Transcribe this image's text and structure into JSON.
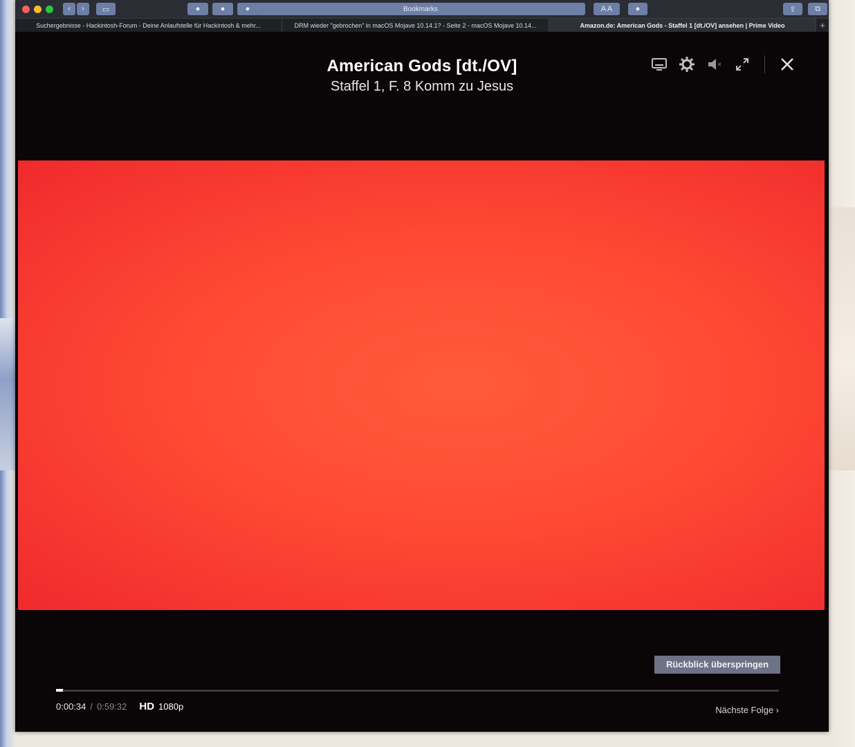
{
  "browser": {
    "url_text": "Bookmarks",
    "tabs": [
      {
        "label": "Suchergebnisse - Hackintosh-Forum - Deine Anlaufstelle für Hackintosh & mehr...",
        "active": false
      },
      {
        "label": "DRM wieder \"gebrochen\" in macOS Mojave 10.14.1? - Seite 2 - macOS Mojave 10.14...",
        "active": false
      },
      {
        "label": "Amazon.de: American Gods - Staffel 1 [dt./OV] ansehen | Prime Video",
        "active": true
      }
    ],
    "new_tab_label": "+"
  },
  "player": {
    "title": "American Gods [dt./OV]",
    "subtitle": "Staffel 1, F. 8 Komm zu Jesus",
    "top_icons": [
      "subtitles-icon",
      "gear-icon",
      "volume-muted-icon",
      "fullscreen-icon",
      "close-icon"
    ],
    "video_color": "#ff4a33",
    "skip_label": "Rückblick überspringen",
    "progress_fraction": 0.0095,
    "current_time": "0:00:34",
    "time_separator": "/",
    "total_time": "0:59:32",
    "quality_badge": "HD",
    "resolution": "1080p",
    "next_episode_label": "Nächste Folge ›"
  }
}
